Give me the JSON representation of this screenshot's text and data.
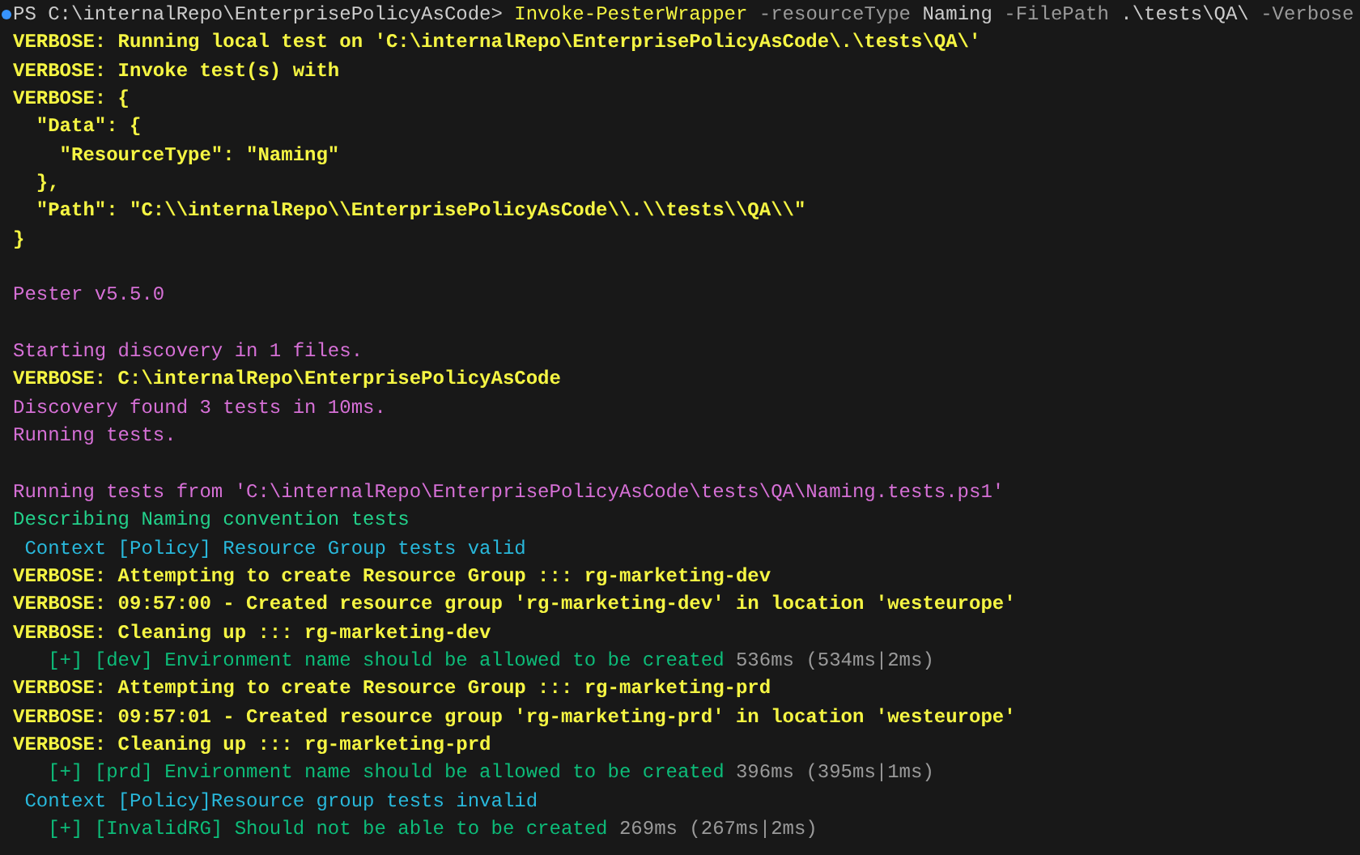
{
  "terminal": {
    "lines": [
      {
        "kind": "text",
        "prompt": true,
        "segments": [
          {
            "kind": "prompt",
            "text": "PS C:\\internalRepo\\EnterprisePolicyAsCode>"
          },
          {
            "kind": "command",
            "text": " Invoke-PesterWrapper"
          },
          {
            "kind": "param",
            "text": " -resourceType"
          },
          {
            "kind": "arg",
            "text": " Naming"
          },
          {
            "kind": "param",
            "text": " -FilePath"
          },
          {
            "kind": "arg",
            "text": " .\\tests\\QA\\"
          },
          {
            "kind": "param",
            "text": " -Verbose"
          }
        ]
      },
      {
        "kind": "text",
        "segments": [
          {
            "kind": "verbose",
            "text": "VERBOSE: Running local test on 'C:\\internalRepo\\EnterprisePolicyAsCode\\.\\tests\\QA\\'"
          }
        ]
      },
      {
        "kind": "text",
        "segments": [
          {
            "kind": "verbose",
            "text": "VERBOSE: Invoke test(s) with"
          }
        ]
      },
      {
        "kind": "text",
        "segments": [
          {
            "kind": "verbose",
            "text": "VERBOSE: {"
          }
        ]
      },
      {
        "kind": "text",
        "segments": [
          {
            "kind": "verbose",
            "text": "  \"Data\": {"
          }
        ]
      },
      {
        "kind": "text",
        "segments": [
          {
            "kind": "verbose",
            "text": "    \"ResourceType\": \"Naming\""
          }
        ]
      },
      {
        "kind": "text",
        "segments": [
          {
            "kind": "verbose",
            "text": "  },"
          }
        ]
      },
      {
        "kind": "text",
        "segments": [
          {
            "kind": "verbose",
            "text": "  \"Path\": \"C:\\\\internalRepo\\\\EnterprisePolicyAsCode\\\\.\\\\tests\\\\QA\\\\\""
          }
        ]
      },
      {
        "kind": "text",
        "segments": [
          {
            "kind": "verbose",
            "text": "}"
          }
        ]
      },
      {
        "kind": "blank"
      },
      {
        "kind": "text",
        "segments": [
          {
            "kind": "info",
            "text": "Pester v5.5.0"
          }
        ]
      },
      {
        "kind": "blank"
      },
      {
        "kind": "text",
        "segments": [
          {
            "kind": "info",
            "text": "Starting discovery in 1 files."
          }
        ]
      },
      {
        "kind": "text",
        "segments": [
          {
            "kind": "verbose",
            "text": "VERBOSE: C:\\internalRepo\\EnterprisePolicyAsCode"
          }
        ]
      },
      {
        "kind": "text",
        "segments": [
          {
            "kind": "info",
            "text": "Discovery found 3 tests in 10ms."
          }
        ]
      },
      {
        "kind": "text",
        "segments": [
          {
            "kind": "info",
            "text": "Running tests."
          }
        ]
      },
      {
        "kind": "blank"
      },
      {
        "kind": "text",
        "segments": [
          {
            "kind": "info",
            "text": "Running tests from 'C:\\internalRepo\\EnterprisePolicyAsCode\\tests\\QA\\Naming.tests.ps1'"
          }
        ]
      },
      {
        "kind": "text",
        "segments": [
          {
            "kind": "describe",
            "text": "Describing Naming convention tests"
          }
        ]
      },
      {
        "kind": "text",
        "segments": [
          {
            "kind": "context",
            "text": " Context [Policy] Resource Group tests valid"
          }
        ]
      },
      {
        "kind": "text",
        "segments": [
          {
            "kind": "verbose",
            "text": "VERBOSE: Attempting to create Resource Group ::: rg-marketing-dev"
          }
        ]
      },
      {
        "kind": "text",
        "segments": [
          {
            "kind": "verbose",
            "text": "VERBOSE: 09:57:00 - Created resource group 'rg-marketing-dev' in location 'westeurope'"
          }
        ]
      },
      {
        "kind": "text",
        "segments": [
          {
            "kind": "verbose",
            "text": "VERBOSE: Cleaning up ::: rg-marketing-dev"
          }
        ]
      },
      {
        "kind": "text",
        "segments": [
          {
            "kind": "pass",
            "text": "   [+] [dev] Environment name should be allowed to be created"
          },
          {
            "kind": "timing",
            "text": " 536ms (534ms|2ms)"
          }
        ]
      },
      {
        "kind": "text",
        "segments": [
          {
            "kind": "verbose",
            "text": "VERBOSE: Attempting to create Resource Group ::: rg-marketing-prd"
          }
        ]
      },
      {
        "kind": "text",
        "segments": [
          {
            "kind": "verbose",
            "text": "VERBOSE: 09:57:01 - Created resource group 'rg-marketing-prd' in location 'westeurope'"
          }
        ]
      },
      {
        "kind": "text",
        "segments": [
          {
            "kind": "verbose",
            "text": "VERBOSE: Cleaning up ::: rg-marketing-prd"
          }
        ]
      },
      {
        "kind": "text",
        "segments": [
          {
            "kind": "pass",
            "text": "   [+] [prd] Environment name should be allowed to be created"
          },
          {
            "kind": "timing",
            "text": " 396ms (395ms|1ms)"
          }
        ]
      },
      {
        "kind": "text",
        "segments": [
          {
            "kind": "context",
            "text": " Context [Policy]Resource group tests invalid"
          }
        ]
      },
      {
        "kind": "text",
        "segments": [
          {
            "kind": "pass",
            "text": "   [+] [InvalidRG] Should not be able to be created"
          },
          {
            "kind": "timing",
            "text": " 269ms (267ms|2ms)"
          }
        ]
      }
    ]
  }
}
